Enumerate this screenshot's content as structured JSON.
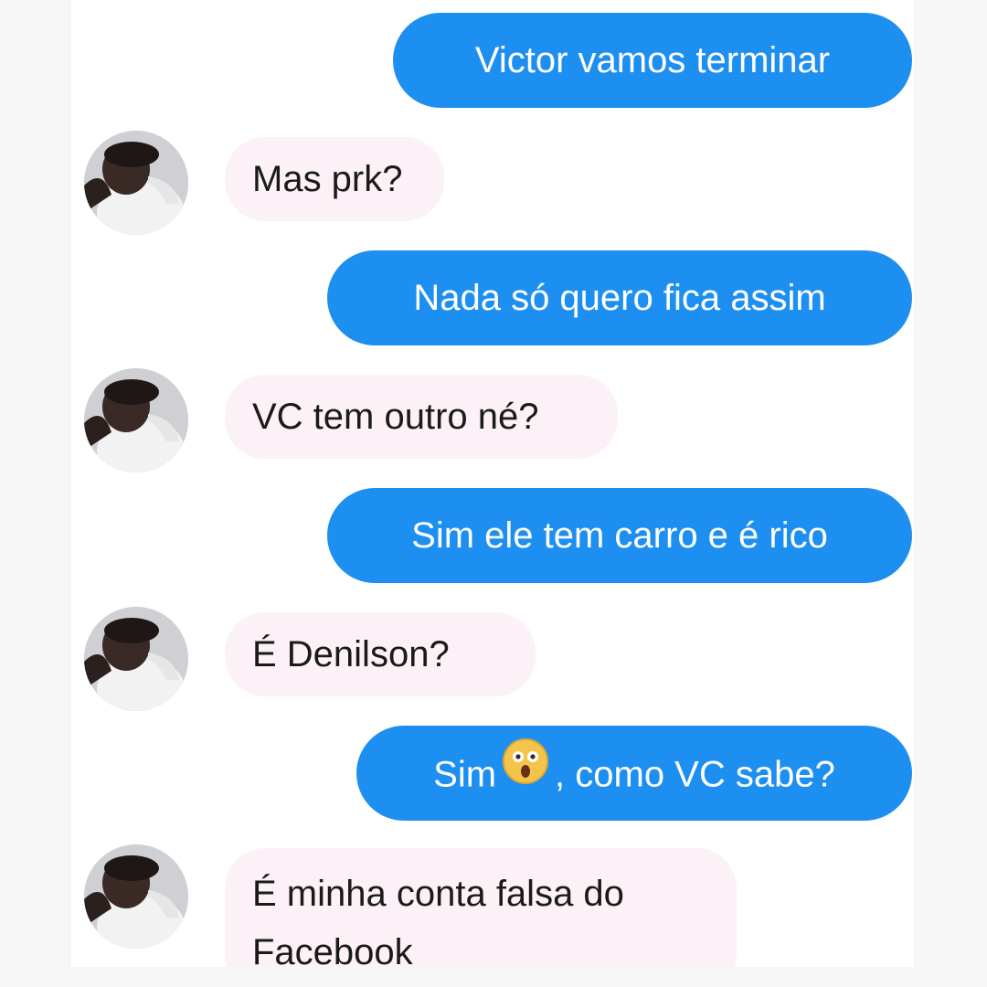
{
  "messages": [
    {
      "side": "sent",
      "text": "Victor vamos terminar"
    },
    {
      "side": "received",
      "text": "Mas prk?"
    },
    {
      "side": "sent",
      "text": "Nada só quero fica assim"
    },
    {
      "side": "received",
      "text": "VC tem outro né?"
    },
    {
      "side": "sent",
      "text": "Sim ele tem carro e é rico"
    },
    {
      "side": "received",
      "text": "É Denilson?"
    },
    {
      "side": "sent",
      "text_before": "Sim",
      "emoji": "astonished-face-icon",
      "text_after": ", como VC sabe?"
    },
    {
      "side": "received",
      "line1": "É minha conta falsa do",
      "line2": "Facebook"
    }
  ],
  "colors": {
    "sent_bubble": "#1d8ff0",
    "sent_text": "#ffffff",
    "received_bubble": "#fbf1f6",
    "received_text": "#1a1a1a",
    "background": "#ffffff",
    "side_margin": "#f6f6f7"
  },
  "avatar_icon": "user-photo-avatar"
}
